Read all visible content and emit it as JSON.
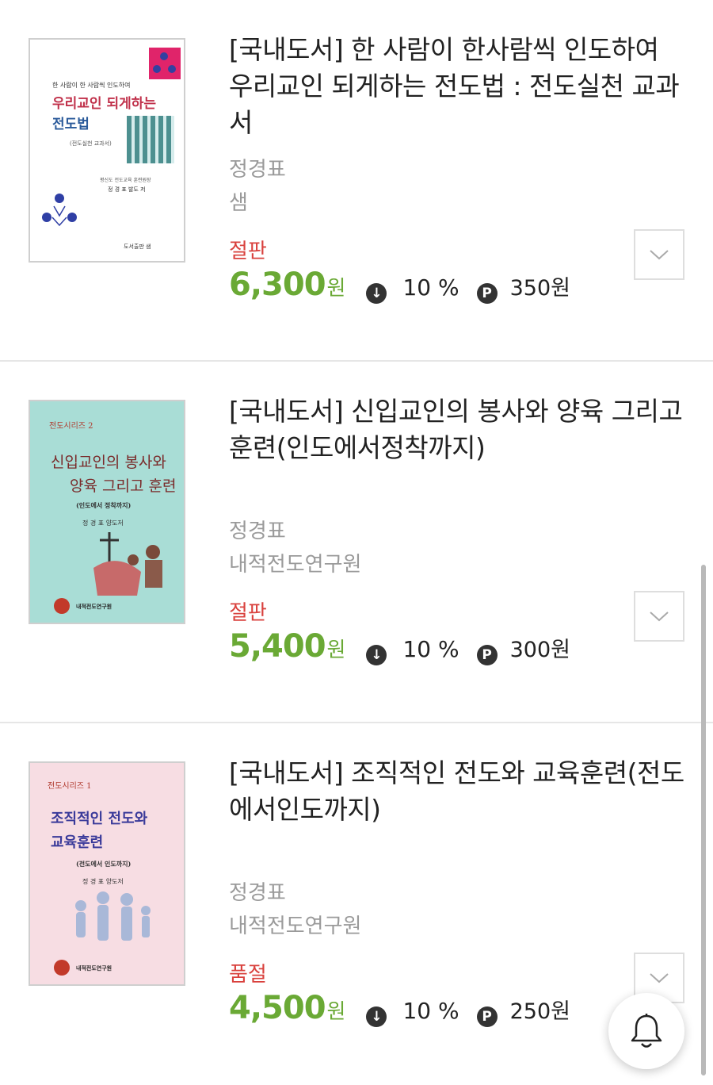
{
  "books": [
    {
      "title": "[국내도서] 한 사람이 한사람씩 인도하여 우리교인 되게하는 전도법 : 전도실천 교과서",
      "author": "정경표",
      "publisher": "샘",
      "status": "절판",
      "price": "6,300",
      "currency": "원",
      "discount": "10 %",
      "points": "350원",
      "cover": {
        "top_line": "한 사람이 한 사람씩 인도하여",
        "title_line1": "우리교인 되게하는",
        "title_line2": "전도법",
        "subtitle": "(전도실천 교과서)",
        "credit1": "평신도 전도교육 훈련원장",
        "credit2": "정 경 표 발도 저",
        "publisher": "도서출판 샘",
        "title_color": "#c0304a",
        "title2_color": "#2a5a9a"
      }
    },
    {
      "title": "[국내도서] 신입교인의 봉사와 양육 그리고 훈련(인도에서정착까지)",
      "author": "정경표",
      "publisher": "내적전도연구원",
      "status": "절판",
      "price": "5,400",
      "currency": "원",
      "discount": "10 %",
      "points": "300원",
      "cover": {
        "series": "전도시리즈 2",
        "title_line1": "신입교인의 봉사와",
        "title_line2": "양육 그리고 훈련",
        "subtitle": "(인도에서 정착까지)",
        "credit": "정 경 표 양도저",
        "publisher": "내적전도연구원",
        "bg": "#a9ddd6"
      }
    },
    {
      "title": "[국내도서] 조직적인 전도와 교육훈련(전도에서인도까지)",
      "author": "정경표",
      "publisher": "내적전도연구원",
      "status": "품절",
      "price": "4,500",
      "currency": "원",
      "discount": "10 %",
      "points": "250원",
      "cover": {
        "series": "전도시리즈 1",
        "title_line1": "조직적인 전도와",
        "title_line2": "교육훈련",
        "subtitle": "(전도에서 인도까지)",
        "credit": "정 경 표 양도저",
        "publisher": "내적전도연구원",
        "bg": "#f7dde3"
      }
    }
  ],
  "icons": {
    "discount": "arrow-down-circle-icon",
    "points": "points-p-icon",
    "expand": "chevron-down-icon",
    "fab": "bell-icon"
  },
  "colors": {
    "price": "#6aa935",
    "status": "#d9413d",
    "muted": "#9a9a9a"
  }
}
